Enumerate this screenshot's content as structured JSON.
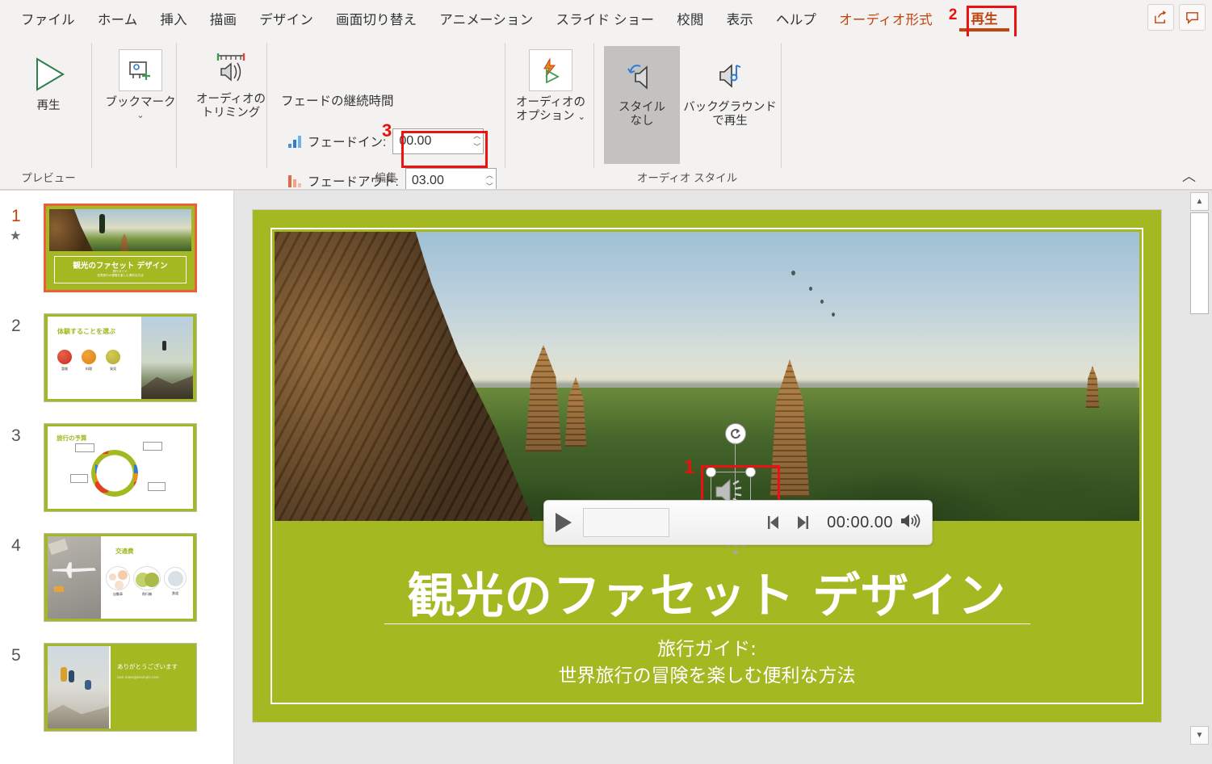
{
  "app": {
    "accent_red": "#c0440f",
    "callout_red": "#ee1111",
    "theme_green": "#a3b821"
  },
  "ribbon": {
    "tabs": [
      {
        "label": "ファイル",
        "state": "normal"
      },
      {
        "label": "ホーム",
        "state": "normal"
      },
      {
        "label": "挿入",
        "state": "normal"
      },
      {
        "label": "描画",
        "state": "normal"
      },
      {
        "label": "デザイン",
        "state": "normal"
      },
      {
        "label": "画面切り替え",
        "state": "normal"
      },
      {
        "label": "アニメーション",
        "state": "normal"
      },
      {
        "label": "スライド ショー",
        "state": "normal"
      },
      {
        "label": "校閲",
        "state": "normal"
      },
      {
        "label": "表示",
        "state": "normal"
      },
      {
        "label": "ヘルプ",
        "state": "normal"
      },
      {
        "label": "オーディオ形式",
        "state": "contextual"
      },
      {
        "label": "再生",
        "state": "active"
      }
    ],
    "callout_tab_number": "2",
    "topright": [
      {
        "icon": "share-icon"
      },
      {
        "icon": "comment-icon"
      }
    ],
    "groups": [
      {
        "label": "プレビュー"
      },
      {
        "label": "編集"
      },
      {
        "label": "オーディオ スタイル"
      }
    ],
    "preview": {
      "play_label": "再生",
      "icon": "play-triangle-icon"
    },
    "bookmark": {
      "label": "ブックマーク",
      "icon": "bookmark-add-icon",
      "has_dropdown": true
    },
    "trim": {
      "label_line1": "オーディオの",
      "label_line2": "トリミング",
      "icon": "audio-trim-icon"
    },
    "fade": {
      "section_title": "フェードの継続時間",
      "fade_in": {
        "label": "フェードイン:",
        "value": "00.00",
        "icon": "fade-in-icon"
      },
      "fade_out": {
        "label": "フェードアウト:",
        "value": "03.00",
        "icon": "fade-out-icon"
      },
      "callout_number": "3"
    },
    "audio_options": {
      "label_line1": "オーディオの",
      "label_line2": "オプション",
      "icon": "audio-options-icon",
      "has_dropdown": true
    },
    "styles": [
      {
        "label_line1": "スタイル",
        "label_line2": "なし",
        "icon": "no-style-icon",
        "selected": true
      },
      {
        "label_line1": "バックグラウンド",
        "label_line2": "で再生",
        "icon": "play-background-icon",
        "selected": false
      }
    ],
    "collapse_icon": "chevron-up-icon"
  },
  "thumbnails": [
    {
      "number": "1",
      "selected": true,
      "has_animation_star": true,
      "type": "title",
      "title": "観光のファセット デザイン",
      "sub1": "旅行ガイド:",
      "sub2": "世界旅行の冒険を楽しむ便利な方法"
    },
    {
      "number": "2",
      "selected": false,
      "has_animation_star": false,
      "type": "three-icons",
      "title": "体験することを選ぶ",
      "items": [
        "冒険",
        "料理",
        "発見"
      ]
    },
    {
      "number": "3",
      "selected": false,
      "has_animation_star": false,
      "type": "donut",
      "title": "旅行の予算"
    },
    {
      "number": "4",
      "selected": false,
      "has_animation_star": false,
      "type": "venn",
      "title": "交通費",
      "items": [
        "自動車",
        "飛行機",
        "鉄道"
      ]
    },
    {
      "number": "5",
      "selected": false,
      "has_animation_star": false,
      "type": "closing",
      "title": "ありがとうございます",
      "sub1": "sam.mase@example.com"
    }
  ],
  "slide": {
    "title": "観光のファセット デザイン",
    "subtitle_line1": "旅行ガイド:",
    "subtitle_line2": "世界旅行の冒険を楽しむ便利な方法",
    "audio_object": {
      "callout_number": "1",
      "icon": "speaker-audio-icon",
      "rotate_handle_icon": "rotate-icon",
      "move_handle_icon": "move-icon"
    },
    "player": {
      "play_icon": "play-icon",
      "back_icon": "step-back-icon",
      "forward_icon": "step-forward-icon",
      "time": "00:00.00",
      "volume_icon": "volume-icon"
    }
  },
  "scrollbar": {
    "up_icon": "scroll-up-icon",
    "down_icon": "scroll-down-icon"
  }
}
